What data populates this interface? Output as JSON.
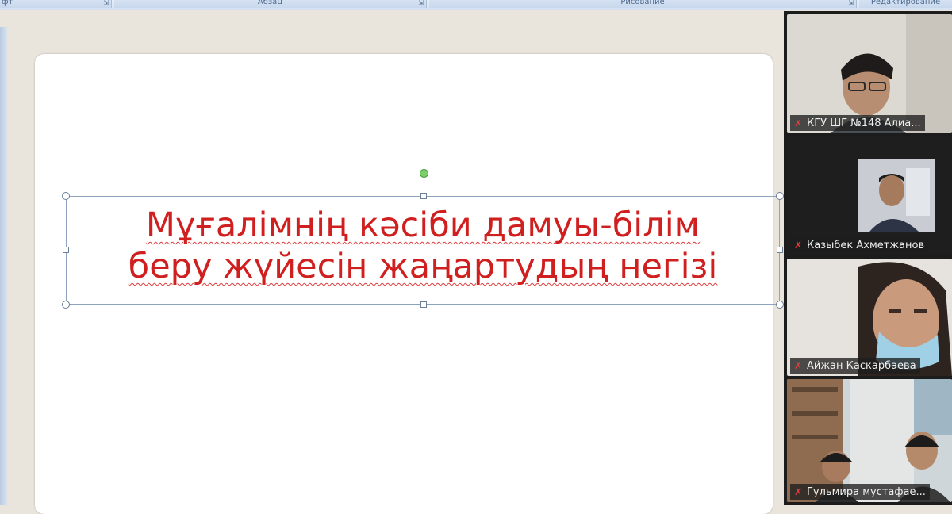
{
  "ribbon": {
    "groups": [
      {
        "label": "фт"
      },
      {
        "label": "Абзац"
      },
      {
        "label": "Рисование"
      },
      {
        "label": "Редактирование"
      }
    ]
  },
  "slide": {
    "title_line1": "Мұғалімнің кәсіби дамуы-білім",
    "title_line2": "беру жүйесін жаңартудың негізі",
    "title_color": "#d01f1f"
  },
  "participants": [
    {
      "name": "КГУ ШГ №148 Алиа...",
      "mic": "muted"
    },
    {
      "name": "Казыбек Ахметжанов",
      "mic": "muted"
    },
    {
      "name": "Айжан Каскарбаева",
      "mic": "muted"
    },
    {
      "name": "Гульмира мустафае...",
      "mic": "muted"
    }
  ],
  "colors": {
    "mic_muted": "#e23b3b",
    "ribbon_bg": "#d4e1f2",
    "workspace_bg": "#e9e4dc"
  }
}
